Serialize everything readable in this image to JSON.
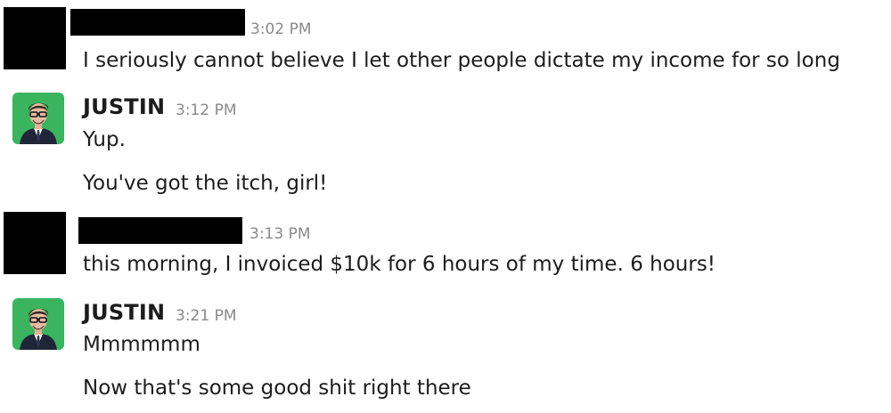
{
  "messages": [
    {
      "author": "",
      "author_redacted": true,
      "timestamp": "3:02 PM",
      "lines": [
        "I seriously cannot believe I let other people dictate my income for so long"
      ]
    },
    {
      "author": "JUSTIN",
      "author_redacted": false,
      "avatar": "justin-avatar",
      "timestamp": "3:12 PM",
      "lines": [
        "Yup.",
        "You've got the itch, girl!"
      ]
    },
    {
      "author": "",
      "author_redacted": true,
      "timestamp": "3:13 PM",
      "lines": [
        "this morning, I invoiced $10k for 6 hours of my time. 6 hours!"
      ]
    },
    {
      "author": "JUSTIN",
      "author_redacted": false,
      "avatar": "justin-avatar",
      "timestamp": "3:21 PM",
      "lines": [
        "Mmmmmm",
        "Now that's some good shit right there"
      ]
    }
  ],
  "colors": {
    "avatar_bg": "#3ab45f",
    "timestamp": "#8a8a8a",
    "text": "#1d1c1d",
    "redaction": "#000000"
  }
}
